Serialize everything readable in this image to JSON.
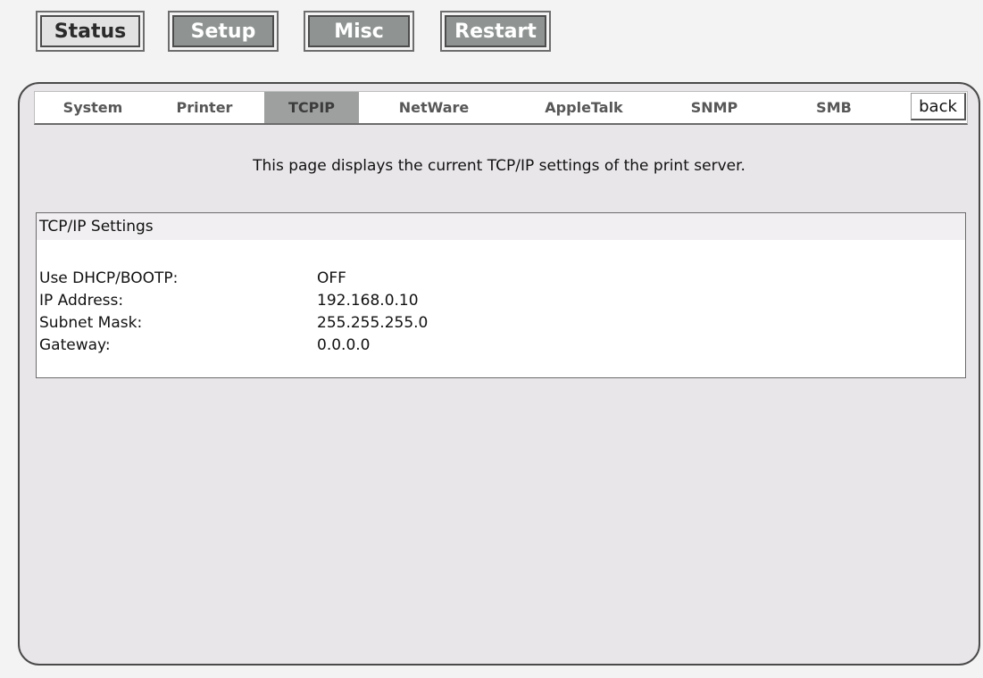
{
  "topnav": {
    "buttons": [
      {
        "label": "Status",
        "state": "active"
      },
      {
        "label": "Setup",
        "state": "inactive"
      },
      {
        "label": "Misc",
        "state": "inactive"
      },
      {
        "label": "Restart",
        "state": "inactive"
      }
    ]
  },
  "tabs": {
    "items": [
      {
        "label": "System"
      },
      {
        "label": "Printer"
      },
      {
        "label": "TCPIP",
        "active": true
      },
      {
        "label": "NetWare"
      },
      {
        "label": "AppleTalk"
      },
      {
        "label": "SNMP"
      },
      {
        "label": "SMB"
      }
    ],
    "back_label": "back"
  },
  "main": {
    "intro": "This page displays the current TCP/IP settings of the print server.",
    "settings": {
      "title": "TCP/IP Settings",
      "rows": [
        {
          "label": "Use DHCP/BOOTP:",
          "value": "OFF"
        },
        {
          "label": "IP Address:",
          "value": "192.168.0.10"
        },
        {
          "label": "Subnet Mask:",
          "value": "255.255.255.0"
        },
        {
          "label": "Gateway:",
          "value": "0.0.0.0"
        }
      ]
    }
  },
  "colors": {
    "page_bg": "#f4f3f4",
    "panel_bg": "#e9e6e9",
    "inactive_button": "#8f9493",
    "active_tab": "#9da09f"
  }
}
